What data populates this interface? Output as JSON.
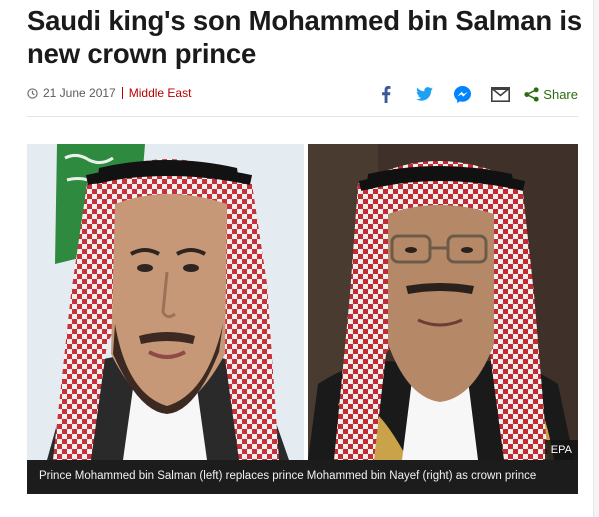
{
  "article": {
    "headline": "Saudi king's son Mohammed bin Salman is new crown prince",
    "date": "21 June 2017",
    "section": "Middle East"
  },
  "share": {
    "label": "Share",
    "icons": [
      "facebook-icon",
      "twitter-icon",
      "messenger-icon",
      "email-icon",
      "share-icon"
    ],
    "colors": {
      "facebook": "#3b5998",
      "twitter": "#1da1f2",
      "messenger": "#0084ff",
      "email": "#404040",
      "share": "#2a6d0f"
    }
  },
  "figure": {
    "credit": "EPA",
    "caption": "Prince Mohammed bin Salman (left) replaces prince Mohammed bin Nayef (right) as crown prince"
  },
  "colors": {
    "accent": "#b80000",
    "caption_bg": "#1c1c1c"
  }
}
